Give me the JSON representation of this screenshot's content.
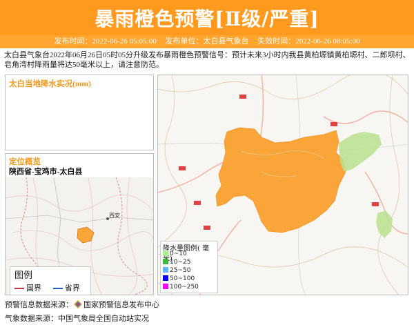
{
  "header": {
    "title": "暴雨橙色预警[Ⅱ级/严重]",
    "publish_time": "发布时间：2022-06-26 05:05:00",
    "publisher": "发布单位：太白县气象台",
    "expire_time": "失效时间：2022-06-26 08:05:00"
  },
  "description": "太白县气象台2022年06月26日05时05分升级发布暴雨橙色预警信号：预计未来3小时内我县黄柏塬镇黄柏塬村、二郎坝村、皂角湾村降雨量将达50毫米以上，请注意防范。",
  "rain_panel": {
    "title": "太白当地降水实况(mm)"
  },
  "location_panel": {
    "title": "定位概览",
    "path": "陕西省-宝鸡市-太白县",
    "map_label": "西安",
    "legend_title": "图例",
    "legend_items": [
      {
        "label": "国界",
        "color": "#c0394b"
      },
      {
        "label": "省界",
        "color": "#1e5fc4"
      }
    ]
  },
  "rain_legend": {
    "title": "降水量图例( 毫米)",
    "items": [
      {
        "label": "0~10",
        "color": "#a6f28f"
      },
      {
        "label": "10~25",
        "color": "#3cb93c"
      },
      {
        "label": "25~50",
        "color": "#61b8ff"
      },
      {
        "label": "50~100",
        "color": "#0000ff"
      },
      {
        "label": "100~250",
        "color": "#fa00fa"
      }
    ]
  },
  "footer": {
    "warning_source": "预警信息数据来源：",
    "warning_source_name": "国家预警信息发布中心",
    "weather_source": "气象数据来源：中国气象局全国自动站实况"
  },
  "colors": {
    "accent": "#ff9a1f",
    "warning_area": "#f9a53a",
    "green_area": "#b8e08e"
  }
}
